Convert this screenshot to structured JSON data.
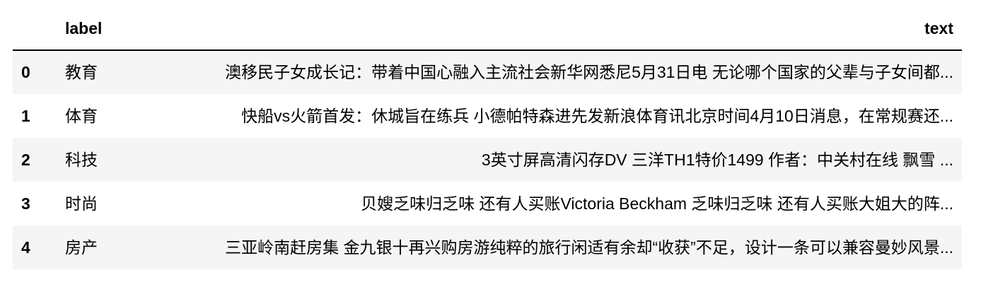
{
  "table": {
    "columns": [
      "",
      "label",
      "text"
    ],
    "rows": [
      {
        "index": "0",
        "label": "教育",
        "text": "澳移民子女成长记：带着中国心融入主流社会新华网悉尼5月31日电 无论哪个国家的父辈与子女间都..."
      },
      {
        "index": "1",
        "label": "体育",
        "text": "快船vs火箭首发：休城旨在练兵 小德帕特森进先发新浪体育讯北京时间4月10日消息，在常规赛还..."
      },
      {
        "index": "2",
        "label": "科技",
        "text": "3英寸屏高清闪存DV 三洋TH1特价1499 作者：中关村在线 飘雪 ..."
      },
      {
        "index": "3",
        "label": "时尚",
        "text": "贝嫂乏味归乏味 还有人买账Victoria Beckham 乏味归乏味 还有人买账大姐大的阵..."
      },
      {
        "index": "4",
        "label": "房产",
        "text": "三亚岭南赶房集 金九银十再兴购房游纯粹的旅行闲适有余却“收获”不足，设计一条可以兼容曼妙风景..."
      }
    ]
  }
}
